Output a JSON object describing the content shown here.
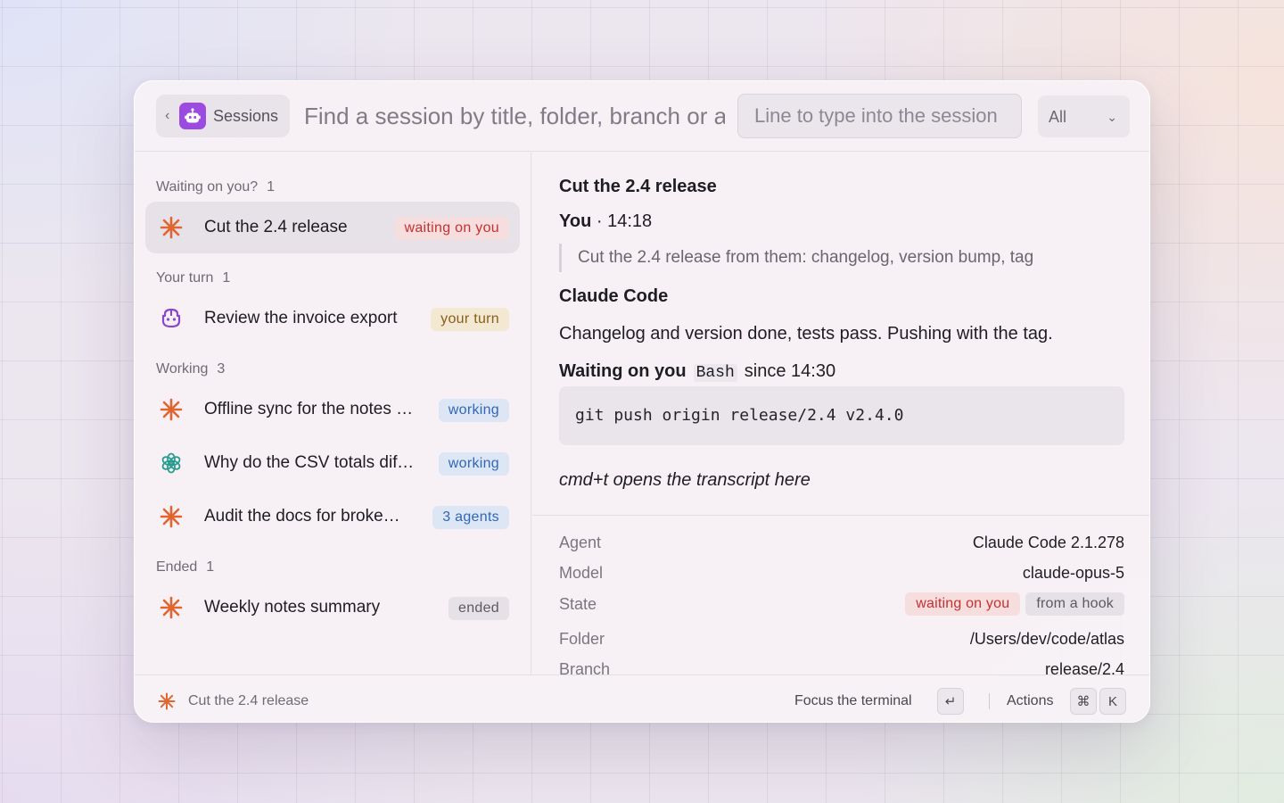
{
  "header": {
    "back_label": "‹",
    "sessions_label": "Sessions",
    "search_placeholder": "Find a session by title, folder, branch or agent",
    "type_placeholder": "Line to type into the session",
    "filter_value": "All"
  },
  "groups": [
    {
      "label": "Waiting on you?",
      "count": "1"
    },
    {
      "label": "Your turn",
      "count": "1"
    },
    {
      "label": "Working",
      "count": "3"
    },
    {
      "label": "Ended",
      "count": "1"
    }
  ],
  "sessions": [
    {
      "title": "Cut the 2.4 release",
      "badge": "waiting on you",
      "icon": "claude-asterisk-icon"
    },
    {
      "title": "Review the invoice export",
      "badge": "your turn",
      "icon": "copilot-icon"
    },
    {
      "title": "Offline sync for the notes app",
      "badge": "working",
      "icon": "claude-asterisk-icon"
    },
    {
      "title": "Why do the CSV totals differ",
      "badge": "working",
      "icon": "openai-icon"
    },
    {
      "title": "Audit the docs for broken links",
      "badge": "3 agents",
      "icon": "claude-asterisk-icon"
    },
    {
      "title": "Weekly notes summary",
      "badge": "ended",
      "icon": "claude-asterisk-icon"
    }
  ],
  "detail": {
    "title": "Cut the 2.4 release",
    "you_label": "You",
    "you_time": "· 14:18",
    "quote": "Cut the 2.4 release from them: changelog, version bump, tag",
    "agent_name": "Claude Code",
    "message": "Changelog and version done, tests pass. Pushing with the tag.",
    "waiting_label": "Waiting on you",
    "waiting_tool": "Bash",
    "waiting_since": "since 14:30",
    "command": "git push origin release/2.4 v2.4.0",
    "hint": "cmd+t opens the transcript here"
  },
  "meta": {
    "agent_key": "Agent",
    "agent_val": "Claude Code 2.1.278",
    "model_key": "Model",
    "model_val": "claude-opus-5",
    "state_key": "State",
    "state_badge1": "waiting on you",
    "state_badge2": "from a hook",
    "folder_key": "Folder",
    "folder_val": "/Users/dev/code/atlas",
    "branch_key": "Branch",
    "branch_val": "release/2.4"
  },
  "footer": {
    "current": "Cut the 2.4 release",
    "focus_label": "Focus the terminal",
    "focus_key": "↵",
    "actions_label": "Actions",
    "actions_key1": "⌘",
    "actions_key2": "K"
  },
  "colors": {
    "accent_purple": "#9b4be0",
    "claude_orange": "#e0652f",
    "waiting_red": "#c6302f",
    "working_blue": "#3266b6",
    "turn_amber": "#8a5d1a"
  }
}
